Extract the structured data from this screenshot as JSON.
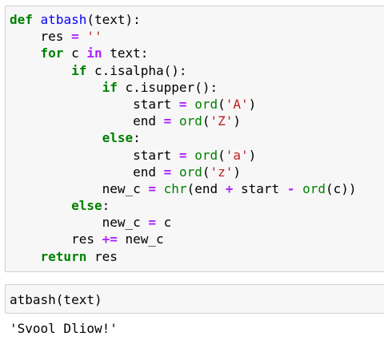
{
  "code_cell": {
    "lines": [
      {
        "indent": "",
        "tokens": [
          {
            "t": "kw",
            "v": "def"
          },
          {
            "t": "tx",
            "v": " "
          },
          {
            "t": "fn",
            "v": "atbash"
          },
          {
            "t": "tx",
            "v": "(text):"
          }
        ]
      },
      {
        "indent": "    ",
        "tokens": [
          {
            "t": "tx",
            "v": "res "
          },
          {
            "t": "op",
            "v": "="
          },
          {
            "t": "tx",
            "v": " "
          },
          {
            "t": "str",
            "v": "''"
          }
        ]
      },
      {
        "indent": "    ",
        "tokens": [
          {
            "t": "kw",
            "v": "for"
          },
          {
            "t": "tx",
            "v": " c "
          },
          {
            "t": "op",
            "v": "in"
          },
          {
            "t": "tx",
            "v": " text:"
          }
        ]
      },
      {
        "indent": "        ",
        "tokens": [
          {
            "t": "kw",
            "v": "if"
          },
          {
            "t": "tx",
            "v": " c.isalpha():"
          }
        ]
      },
      {
        "indent": "            ",
        "tokens": [
          {
            "t": "kw",
            "v": "if"
          },
          {
            "t": "tx",
            "v": " c.isupper():"
          }
        ]
      },
      {
        "indent": "                ",
        "tokens": [
          {
            "t": "tx",
            "v": "start "
          },
          {
            "t": "op",
            "v": "="
          },
          {
            "t": "tx",
            "v": " "
          },
          {
            "t": "bi",
            "v": "ord"
          },
          {
            "t": "tx",
            "v": "("
          },
          {
            "t": "str",
            "v": "'A'"
          },
          {
            "t": "tx",
            "v": ")"
          }
        ]
      },
      {
        "indent": "                ",
        "tokens": [
          {
            "t": "tx",
            "v": "end "
          },
          {
            "t": "op",
            "v": "="
          },
          {
            "t": "tx",
            "v": " "
          },
          {
            "t": "bi",
            "v": "ord"
          },
          {
            "t": "tx",
            "v": "("
          },
          {
            "t": "str",
            "v": "'Z'"
          },
          {
            "t": "tx",
            "v": ")"
          }
        ]
      },
      {
        "indent": "            ",
        "tokens": [
          {
            "t": "kw",
            "v": "else"
          },
          {
            "t": "tx",
            "v": ":"
          }
        ]
      },
      {
        "indent": "                ",
        "tokens": [
          {
            "t": "tx",
            "v": "start "
          },
          {
            "t": "op",
            "v": "="
          },
          {
            "t": "tx",
            "v": " "
          },
          {
            "t": "bi",
            "v": "ord"
          },
          {
            "t": "tx",
            "v": "("
          },
          {
            "t": "str",
            "v": "'a'"
          },
          {
            "t": "tx",
            "v": ")"
          }
        ]
      },
      {
        "indent": "                ",
        "tokens": [
          {
            "t": "tx",
            "v": "end "
          },
          {
            "t": "op",
            "v": "="
          },
          {
            "t": "tx",
            "v": " "
          },
          {
            "t": "bi",
            "v": "ord"
          },
          {
            "t": "tx",
            "v": "("
          },
          {
            "t": "str",
            "v": "'z'"
          },
          {
            "t": "tx",
            "v": ")"
          }
        ]
      },
      {
        "indent": "            ",
        "tokens": [
          {
            "t": "tx",
            "v": "new_c "
          },
          {
            "t": "op",
            "v": "="
          },
          {
            "t": "tx",
            "v": " "
          },
          {
            "t": "bi",
            "v": "chr"
          },
          {
            "t": "tx",
            "v": "(end "
          },
          {
            "t": "op",
            "v": "+"
          },
          {
            "t": "tx",
            "v": " start "
          },
          {
            "t": "op",
            "v": "-"
          },
          {
            "t": "tx",
            "v": " "
          },
          {
            "t": "bi",
            "v": "ord"
          },
          {
            "t": "tx",
            "v": "(c))"
          }
        ]
      },
      {
        "indent": "        ",
        "tokens": [
          {
            "t": "kw",
            "v": "else"
          },
          {
            "t": "tx",
            "v": ":"
          }
        ]
      },
      {
        "indent": "            ",
        "tokens": [
          {
            "t": "tx",
            "v": "new_c "
          },
          {
            "t": "op",
            "v": "="
          },
          {
            "t": "tx",
            "v": " c"
          }
        ]
      },
      {
        "indent": "        ",
        "tokens": [
          {
            "t": "tx",
            "v": "res "
          },
          {
            "t": "op",
            "v": "+="
          },
          {
            "t": "tx",
            "v": " new_c"
          }
        ]
      },
      {
        "indent": "    ",
        "tokens": [
          {
            "t": "kw",
            "v": "return"
          },
          {
            "t": "tx",
            "v": " res"
          }
        ]
      }
    ]
  },
  "call_cell": {
    "code": "atbash(text)"
  },
  "output": {
    "text": "'Svool Dliow!'"
  },
  "colors": {
    "keyword": "#008000",
    "function_name": "#0000ff",
    "operator": "#aa22ff",
    "string": "#ba2121",
    "builtin": "#008000",
    "cell_background": "#f7f7f7",
    "cell_border": "#cfcfcf"
  }
}
